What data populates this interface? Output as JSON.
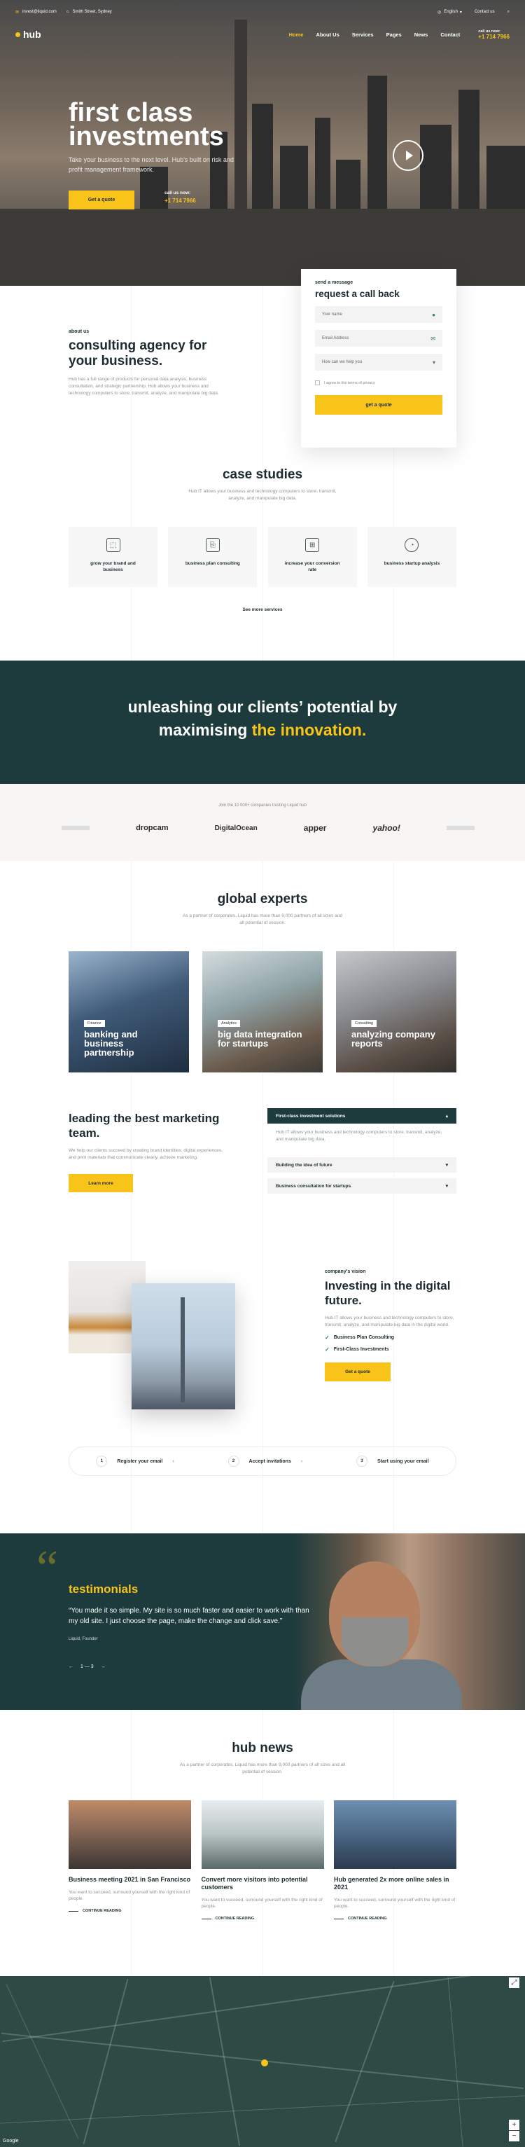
{
  "topbar": {
    "email": "invest@liquid.com",
    "address": "Smith Street, Sydney",
    "language": "English",
    "contact": "Contact us"
  },
  "nav": {
    "logo": "hub",
    "items": [
      "Home",
      "About Us",
      "Services",
      "Pages",
      "News",
      "Contact"
    ],
    "phone_label": "call us now:",
    "phone": "+1 714 7966"
  },
  "hero": {
    "title_line1": "first class",
    "title_line2": "investments",
    "subtitle": "Take your business to the next level. Hub's built on risk and profit management framework.",
    "cta": "Get a quote",
    "call_label": "call us now:",
    "call_number": "+1 714 7966"
  },
  "form": {
    "eyebrow": "send a message",
    "title": "request a call back",
    "name_placeholder": "Your name",
    "email_placeholder": "Email Address",
    "select_placeholder": "How can we help you",
    "terms": "I agree to the terms of privacy",
    "submit": "get a quote"
  },
  "about": {
    "eyebrow": "about us",
    "title": "consulting agency for your business.",
    "text": "Hub has a full range of products for personal data analysis, business consultation, and strategic partnership. Hub allows your business and technology computers to store, transmit, analyze, and manipulate big data."
  },
  "case_studies": {
    "title": "case studies",
    "text": "Hub IT allows your business and technology computers to store, transmit, analyze, and manipulate big data.",
    "cards": [
      "grow your brand and business",
      "business plan consulting",
      "increase your conversion rate",
      "business startup analysis"
    ],
    "see_more": "See more services"
  },
  "banner": {
    "line1": "unleashing our clients’ potential by",
    "line2a": "maximising ",
    "line2b": "the innovation."
  },
  "logos": {
    "caption": "Join the 10 000+ companies trusting Liquid hub",
    "items": [
      "dropcam",
      "DigitalOcean",
      "apper",
      "yahoo!"
    ]
  },
  "experts": {
    "title": "global experts",
    "text": "As a partner of corporates, Liquid has more than 9,000 partners of all sizes and all potential of session.",
    "cards": [
      {
        "tag": "Finance",
        "title": "banking and business partnership"
      },
      {
        "tag": "Analytics",
        "title": "big data integration for startups"
      },
      {
        "tag": "Consulting",
        "title": "analyzing company reports"
      }
    ]
  },
  "marketing": {
    "title": "leading the best marketing team.",
    "text": "We help our clients succeed by creating brand identities, digital experiences, and print materials that communicate clearly, achieve marketing.",
    "cta": "Learn more",
    "accordion": [
      {
        "title": "First-class investment solutions",
        "body": "Hub IT allows your business and technology computers to store, transmit, analyze, and manipulate big data."
      },
      {
        "title": "Building the idea of future"
      },
      {
        "title": "Business consultation for startups"
      }
    ]
  },
  "vision": {
    "eyebrow": "company's vision",
    "title": "Investing in the digital future.",
    "text": "Hub IT allows your business and technology computers to store, transmit, analyze, and manipulate big data in the digital world.",
    "checks": [
      "Business Plan Consulting",
      "First-Class Investments"
    ],
    "cta": "Get a quote"
  },
  "steps": [
    {
      "n": "1",
      "label": "Register your email"
    },
    {
      "n": "2",
      "label": "Accept invitations"
    },
    {
      "n": "3",
      "label": "Start using your email"
    }
  ],
  "testimonials": {
    "title": "testimonials",
    "quote": "“You made it so simple. My site is so much faster and easier to work with than my old site. I just choose the page, make the change and click save.”",
    "author": "Liquid, Founder",
    "pager": "1 — 3"
  },
  "news": {
    "title": "hub news",
    "text": "As a partner of corporates, Liquid has more than 9,000 partners of all sizes and all potential of session.",
    "items": [
      {
        "title": "Business meeting 2021 in San Francisco",
        "desc": "You want to succeed, surround yourself with the right kind of people.",
        "more": "CONTINUE READING"
      },
      {
        "title": "Convert more visitors into potential customers",
        "desc": "You want to succeed, surround yourself with the right kind of people.",
        "more": "CONTINUE READING"
      },
      {
        "title": "Hub generated 2x more online sales in 2021",
        "desc": "You want to succeed, surround yourself with the right kind of people.",
        "more": "CONTINUE READING"
      }
    ]
  },
  "map": {
    "zoom_in": "+",
    "zoom_out": "−",
    "credit": "Google"
  },
  "colors": {
    "accent": "#f8c41a",
    "dark_green": "#1d3b3c",
    "text": "#1d2b2f"
  }
}
